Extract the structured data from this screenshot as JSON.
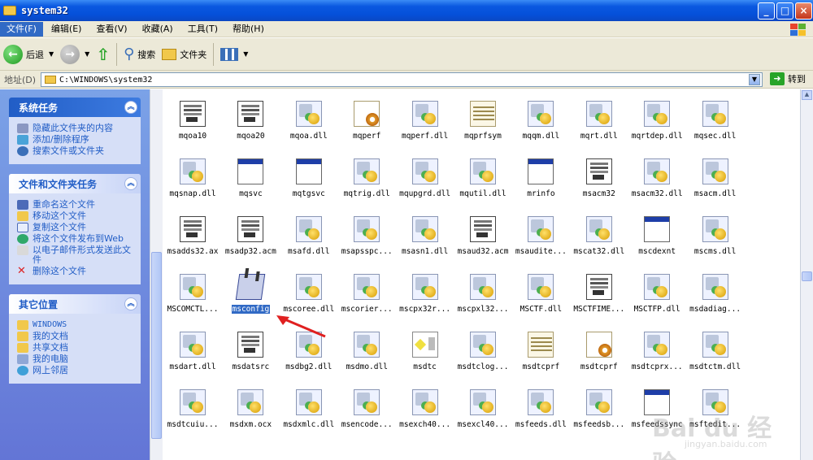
{
  "window": {
    "title": "system32"
  },
  "menu": [
    "文件(F)",
    "编辑(E)",
    "查看(V)",
    "收藏(A)",
    "工具(T)",
    "帮助(H)"
  ],
  "toolbar": {
    "back": "后退",
    "search": "搜索",
    "folders": "文件夹"
  },
  "address": {
    "label": "地址(D)",
    "value": "C:\\WINDOWS\\system32",
    "go": "转到"
  },
  "panels": {
    "system_tasks": {
      "title": "系统任务",
      "items": [
        "隐藏此文件夹的内容",
        "添加/删除程序",
        "搜索文件或文件夹"
      ]
    },
    "file_tasks": {
      "title": "文件和文件夹任务",
      "items": [
        "重命名这个文件",
        "移动这个文件",
        "复制这个文件",
        "将这个文件发布到Web",
        "以电子邮件形式发送此文件",
        "删除这个文件"
      ]
    },
    "other_places": {
      "title": "其它位置",
      "items": [
        "WINDOWS",
        "我的文档",
        "共享文档",
        "我的电脑",
        "网上邻居"
      ]
    }
  },
  "files": [
    {
      "name": "mqoa10",
      "icon": "doc-icon"
    },
    {
      "name": "mqoa20",
      "icon": "doc-icon"
    },
    {
      "name": "mqoa.dll",
      "icon": "dll-icon"
    },
    {
      "name": "mqperf",
      "icon": "gear-file-icon"
    },
    {
      "name": "mqperf.dll",
      "icon": "dll-icon"
    },
    {
      "name": "mqprfsym",
      "icon": "sys-file-icon"
    },
    {
      "name": "mqqm.dll",
      "icon": "dll-icon"
    },
    {
      "name": "mqrt.dll",
      "icon": "dll-icon"
    },
    {
      "name": "mqrtdep.dll",
      "icon": "dll-icon"
    },
    {
      "name": "mqsec.dll",
      "icon": "dll-icon"
    },
    {
      "name": "mqsnap.dll",
      "icon": "dll-icon"
    },
    {
      "name": "mqsvc",
      "icon": "exe-icon"
    },
    {
      "name": "mqtgsvc",
      "icon": "exe-icon"
    },
    {
      "name": "mqtrig.dll",
      "icon": "dll-icon"
    },
    {
      "name": "mqupgrd.dll",
      "icon": "dll-icon"
    },
    {
      "name": "mqutil.dll",
      "icon": "dll-icon"
    },
    {
      "name": "mrinfo",
      "icon": "exe-icon"
    },
    {
      "name": "msacm32",
      "icon": "doc-icon"
    },
    {
      "name": "msacm32.dll",
      "icon": "dll-icon"
    },
    {
      "name": "msacm.dll",
      "icon": "dll-icon"
    },
    {
      "name": "msadds32.ax",
      "icon": "doc-icon"
    },
    {
      "name": "msadp32.acm",
      "icon": "doc-icon"
    },
    {
      "name": "msafd.dll",
      "icon": "dll-icon"
    },
    {
      "name": "msapsspc...",
      "icon": "dll-icon"
    },
    {
      "name": "msasn1.dll",
      "icon": "dll-icon"
    },
    {
      "name": "msaud32.acm",
      "icon": "doc-icon"
    },
    {
      "name": "msaudite...",
      "icon": "dll-icon"
    },
    {
      "name": "mscat32.dll",
      "icon": "dll-icon"
    },
    {
      "name": "mscdexnt",
      "icon": "exe-icon"
    },
    {
      "name": "mscms.dll",
      "icon": "dll-icon"
    },
    {
      "name": "MSCOMCTL...",
      "icon": "dll-icon"
    },
    {
      "name": "msconfig",
      "icon": "msconfig-icon",
      "selected": true
    },
    {
      "name": "mscoree.dll",
      "icon": "dll-icon"
    },
    {
      "name": "mscorier...",
      "icon": "dll-icon"
    },
    {
      "name": "mscpx32r...",
      "icon": "dll-icon"
    },
    {
      "name": "mscpxl32...",
      "icon": "dll-icon"
    },
    {
      "name": "MSCTF.dll",
      "icon": "dll-icon"
    },
    {
      "name": "MSCTFIME...",
      "icon": "doc-icon"
    },
    {
      "name": "MSCTFP.dll",
      "icon": "dll-icon"
    },
    {
      "name": "msdadiag...",
      "icon": "dll-icon"
    },
    {
      "name": "msdart.dll",
      "icon": "dll-icon"
    },
    {
      "name": "msdatsrc",
      "icon": "doc-icon"
    },
    {
      "name": "msdbg2.dll",
      "icon": "dll-icon"
    },
    {
      "name": "msdmo.dll",
      "icon": "dll-icon"
    },
    {
      "name": "msdtc",
      "icon": "msdtc-icon"
    },
    {
      "name": "msdtclog...",
      "icon": "dll-icon"
    },
    {
      "name": "msdtcprf",
      "icon": "sys-file-icon"
    },
    {
      "name": "msdtcprf",
      "icon": "gear-file-icon"
    },
    {
      "name": "msdtcprx...",
      "icon": "dll-icon"
    },
    {
      "name": "msdtctm.dll",
      "icon": "dll-icon"
    },
    {
      "name": "msdtcuiu...",
      "icon": "dll-icon"
    },
    {
      "name": "msdxm.ocx",
      "icon": "dll-icon"
    },
    {
      "name": "msdxmlc.dll",
      "icon": "dll-icon"
    },
    {
      "name": "msencode...",
      "icon": "dll-icon"
    },
    {
      "name": "msexch40...",
      "icon": "dll-icon"
    },
    {
      "name": "msexcl40...",
      "icon": "dll-icon"
    },
    {
      "name": "msfeeds.dll",
      "icon": "dll-icon"
    },
    {
      "name": "msfeedsb...",
      "icon": "dll-icon"
    },
    {
      "name": "msfeedssync",
      "icon": "exe-icon"
    },
    {
      "name": "msftedit...",
      "icon": "dll-icon"
    }
  ],
  "watermark": {
    "brand": "Bai du 经验",
    "url": "jingyan.baidu.com"
  },
  "colors": {
    "title_bar": "#0550d9",
    "task_pane": "#6b8fe0",
    "selection": "#316ac5",
    "arrow": "#e02020"
  }
}
